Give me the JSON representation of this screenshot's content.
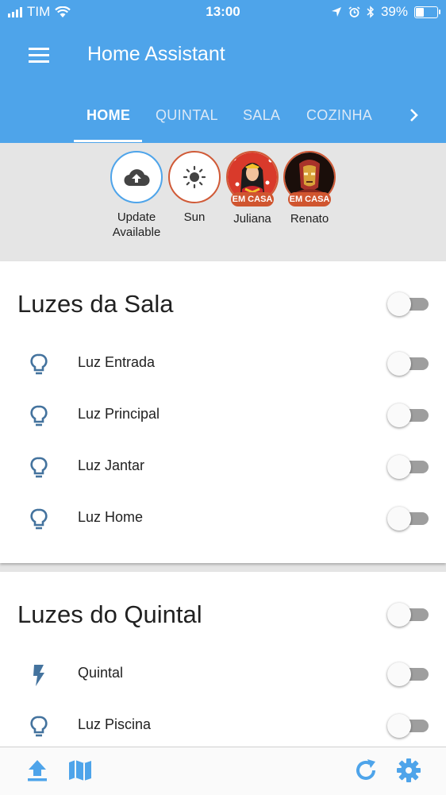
{
  "status_bar": {
    "carrier": "TIM",
    "time": "13:00",
    "battery_text": "39%",
    "battery_level": 0.39,
    "icons": [
      "signal-icon",
      "wifi-icon",
      "location-icon",
      "alarm-icon",
      "bluetooth-icon",
      "battery-icon"
    ]
  },
  "header": {
    "title": "Home Assistant",
    "menu_icon": "menu-icon"
  },
  "tabs": [
    {
      "label": "HOME",
      "active": true
    },
    {
      "label": "QUINTAL",
      "active": false
    },
    {
      "label": "SALA",
      "active": false
    },
    {
      "label": "COZINHA",
      "active": false
    }
  ],
  "tabs_next_icon": "chevron-right-icon",
  "badges": [
    {
      "label": "Update Available",
      "icon": "cloud-upload-icon"
    },
    {
      "label": "Sun",
      "icon": "sun-icon"
    },
    {
      "label": "Juliana",
      "status": "EM CASA",
      "avatar": "wonder-woman-avatar"
    },
    {
      "label": "Renato",
      "status": "EM CASA",
      "avatar": "iron-man-avatar"
    }
  ],
  "cards": [
    {
      "title": "Luzes da Sala",
      "toggle_on": false,
      "rows": [
        {
          "name": "Luz Entrada",
          "icon": "lightbulb-icon",
          "on": false
        },
        {
          "name": "Luz Principal",
          "icon": "lightbulb-icon",
          "on": false
        },
        {
          "name": "Luz Jantar",
          "icon": "lightbulb-icon",
          "on": false
        },
        {
          "name": "Luz Home",
          "icon": "lightbulb-icon",
          "on": false
        }
      ]
    },
    {
      "title": "Luzes do Quintal",
      "toggle_on": false,
      "rows": [
        {
          "name": "Quintal",
          "icon": "flash-icon",
          "on": false
        },
        {
          "name": "Luz Piscina",
          "icon": "lightbulb-icon",
          "on": false
        }
      ]
    }
  ],
  "bottom_bar": {
    "icons": [
      "upload-icon",
      "map-icon",
      "refresh-icon",
      "settings-icon"
    ]
  },
  "colors": {
    "primary": "#4ea4ea",
    "accent_red": "#d05a37",
    "icon_blue": "#44739e",
    "toggle_off": "#9e9e9e"
  }
}
